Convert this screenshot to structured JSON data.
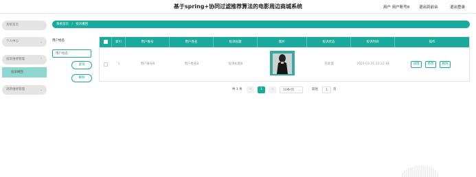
{
  "header": {
    "title": "基于spring+协同过滤推荐算法的电影周边商城系统",
    "user_label": "用户 用户账号8",
    "exit_to_front": "退出到前台",
    "logout": "退出登录"
  },
  "sidebar": {
    "items": [
      {
        "label": "系统首页"
      },
      {
        "label": "个人中心"
      },
      {
        "label": "投诉维修管理"
      },
      {
        "label": "投诉撤回"
      },
      {
        "label": "退款维修管理"
      }
    ]
  },
  "breadcrumb": {
    "home": "系统首页",
    "separator": "/",
    "current": "投诉撤回"
  },
  "filter": {
    "label": "用户姓名",
    "placeholder": "用户姓名",
    "search_button": "查询",
    "delete_button": "删除"
  },
  "table": {
    "headers": [
      "索引",
      "用户账号",
      "用户姓名",
      "投诉标题",
      "图片",
      "投诉状态",
      "投诉时间",
      "操作"
    ],
    "rows": [
      {
        "index": "1",
        "account": "用户账号8",
        "name": "用户姓名8",
        "title": "投诉标题8",
        "status": "已处理",
        "time": "2023-03-31 22:22:34",
        "actions": [
          "详情",
          "修改",
          "删除"
        ]
      }
    ]
  },
  "pagination": {
    "total": "共 1 条",
    "prev": "<",
    "current_page": "1",
    "next": ">",
    "page_size": "10条/页",
    "goto_label": "前往",
    "goto_value": "1",
    "page_unit": "页"
  },
  "colors": {
    "accent": "#19a99d",
    "sidebar_active": "#8fd6d0"
  }
}
